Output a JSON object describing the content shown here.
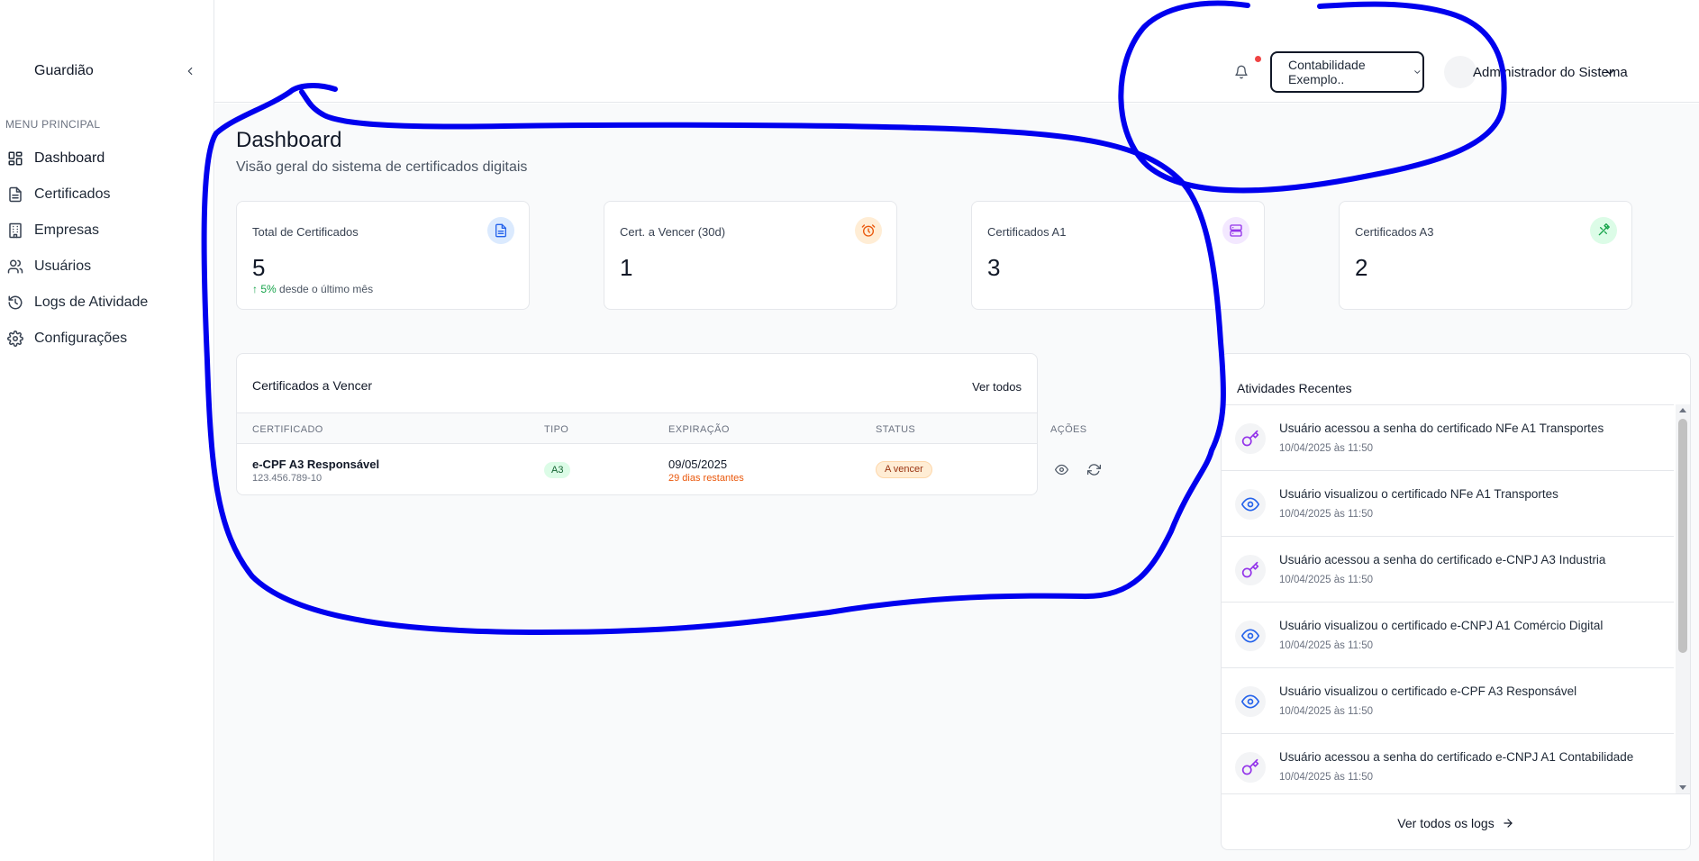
{
  "sidebar": {
    "brand": "Guardião",
    "menu_heading": "MENU PRINCIPAL",
    "items": [
      {
        "label": "Dashboard",
        "icon": "layout-grid-icon"
      },
      {
        "label": "Certificados",
        "icon": "file-text-icon"
      },
      {
        "label": "Empresas",
        "icon": "building-icon"
      },
      {
        "label": "Usuários",
        "icon": "users-icon"
      },
      {
        "label": "Logs de Atividade",
        "icon": "history-icon"
      },
      {
        "label": "Configurações",
        "icon": "gear-icon"
      }
    ]
  },
  "header": {
    "company_select": "Contabilidade Exemplo..",
    "user_name": "Administrador do Sistema"
  },
  "page": {
    "title": "Dashboard",
    "subtitle": "Visão geral do sistema de certificados digitais"
  },
  "stats": [
    {
      "label": "Total de Certificados",
      "value": "5",
      "trend_value": "↑ 5%",
      "trend_text": " desde o último mês",
      "icon": "file-text-icon",
      "color": "#2563eb",
      "bg": "#dbeafe"
    },
    {
      "label": "Cert. a Vencer (30d)",
      "value": "1",
      "icon": "alarm-clock-icon",
      "color": "#ea580c",
      "bg": "#ffedd5"
    },
    {
      "label": "Certificados A1",
      "value": "3",
      "icon": "server-icon",
      "color": "#9333ea",
      "bg": "#f3e8ff"
    },
    {
      "label": "Certificados A3",
      "value": "2",
      "icon": "usb-icon",
      "color": "#16a34a",
      "bg": "#dcfce7"
    }
  ],
  "expiring": {
    "title": "Certificados a Vencer",
    "link": "Ver todos",
    "columns": [
      "CERTIFICADO",
      "TIPO",
      "EXPIRAÇÃO",
      "STATUS",
      "AÇÕES"
    ],
    "rows": [
      {
        "name": "e-CPF A3 Responsável",
        "id": "123.456.789-10",
        "type": "A3",
        "date": "09/05/2025",
        "remaining": "29 dias restantes",
        "status": "A vencer"
      }
    ]
  },
  "activities": {
    "title": "Atividades Recentes",
    "items": [
      {
        "text": "Usuário acessou a senha do certificado NFe A1 Transportes",
        "time": "10/04/2025 às 11:50",
        "icon": "key-icon"
      },
      {
        "text": "Usuário visualizou o certificado NFe A1 Transportes",
        "time": "10/04/2025 às 11:50",
        "icon": "eye-icon"
      },
      {
        "text": "Usuário acessou a senha do certificado e-CNPJ A3 Industria",
        "time": "10/04/2025 às 11:50",
        "icon": "key-icon"
      },
      {
        "text": "Usuário visualizou o certificado e-CNPJ A1 Comércio Digital",
        "time": "10/04/2025 às 11:50",
        "icon": "eye-icon"
      },
      {
        "text": "Usuário visualizou o certificado e-CPF A3 Responsável",
        "time": "10/04/2025 às 11:50",
        "icon": "eye-icon"
      },
      {
        "text": "Usuário acessou a senha do certificado e-CNPJ A1 Contabilidade",
        "time": "10/04/2025 às 11:50",
        "icon": "key-icon"
      }
    ],
    "footer_link": "Ver todos os logs"
  },
  "colors": {
    "annotation": "#0000ee",
    "key_icon": "#9333ea",
    "eye_icon": "#2563eb",
    "notification_dot": "#ef4444"
  }
}
